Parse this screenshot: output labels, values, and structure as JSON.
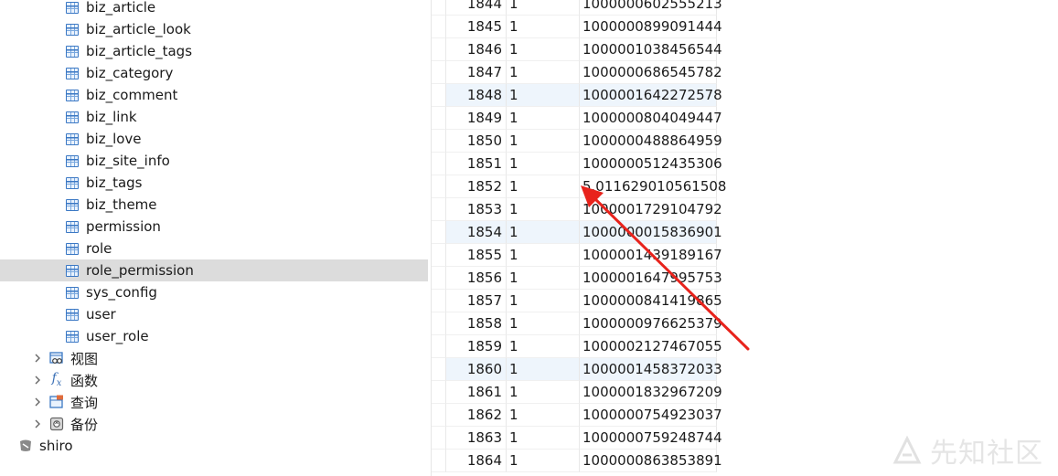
{
  "navigator": {
    "tables": [
      "biz_article",
      "biz_article_look",
      "biz_article_tags",
      "biz_category",
      "biz_comment",
      "biz_link",
      "biz_love",
      "biz_site_info",
      "biz_tags",
      "biz_theme",
      "permission",
      "role",
      "role_permission",
      "sys_config",
      "user",
      "user_role"
    ],
    "selected_table": "role_permission",
    "groups": [
      {
        "label": "视图",
        "icon": "view-icon"
      },
      {
        "label": "函数",
        "icon": "function-icon"
      },
      {
        "label": "查询",
        "icon": "query-icon"
      },
      {
        "label": "备份",
        "icon": "backup-icon"
      }
    ],
    "connection": {
      "label": "shiro",
      "icon": "connection-icon"
    }
  },
  "grid": {
    "rows": [
      {
        "id": "1844",
        "col2": "1",
        "col3": "1000000602555213"
      },
      {
        "id": "1845",
        "col2": "1",
        "col3": "1000000899091444"
      },
      {
        "id": "1846",
        "col2": "1",
        "col3": "1000001038456544"
      },
      {
        "id": "1847",
        "col2": "1",
        "col3": "1000000686545782"
      },
      {
        "id": "1848",
        "col2": "1",
        "col3": "1000001642272578"
      },
      {
        "id": "1849",
        "col2": "1",
        "col3": "1000000804049447"
      },
      {
        "id": "1850",
        "col2": "1",
        "col3": "1000000488864959"
      },
      {
        "id": "1851",
        "col2": "1",
        "col3": "1000000512435306"
      },
      {
        "id": "1852",
        "col2": "1",
        "col3": "5.011629010561508"
      },
      {
        "id": "1853",
        "col2": "1",
        "col3": "1000001729104792"
      },
      {
        "id": "1854",
        "col2": "1",
        "col3": "1000000015836901"
      },
      {
        "id": "1855",
        "col2": "1",
        "col3": "1000001439189167"
      },
      {
        "id": "1856",
        "col2": "1",
        "col3": "1000001647995753"
      },
      {
        "id": "1857",
        "col2": "1",
        "col3": "1000000841419865"
      },
      {
        "id": "1858",
        "col2": "1",
        "col3": "1000000976625379"
      },
      {
        "id": "1859",
        "col2": "1",
        "col3": "1000002127467055"
      },
      {
        "id": "1860",
        "col2": "1",
        "col3": "1000001458372033"
      },
      {
        "id": "1861",
        "col2": "1",
        "col3": "1000001832967209"
      },
      {
        "id": "1862",
        "col2": "1",
        "col3": "1000000754923037"
      },
      {
        "id": "1863",
        "col2": "1",
        "col3": "1000000759248744"
      },
      {
        "id": "1864",
        "col2": "1",
        "col3": "1000000863853891"
      }
    ],
    "highlighted_rows": [
      "1848",
      "1854",
      "1860"
    ],
    "annotated_row": "1852"
  },
  "annotation": {
    "arrow_color": "#e8231c"
  },
  "watermark": {
    "text": "先知社区"
  },
  "colors": {
    "selection": "#dcdcdc",
    "table_icon": "#3b78c4",
    "row_highlight": "#eef5fc"
  }
}
